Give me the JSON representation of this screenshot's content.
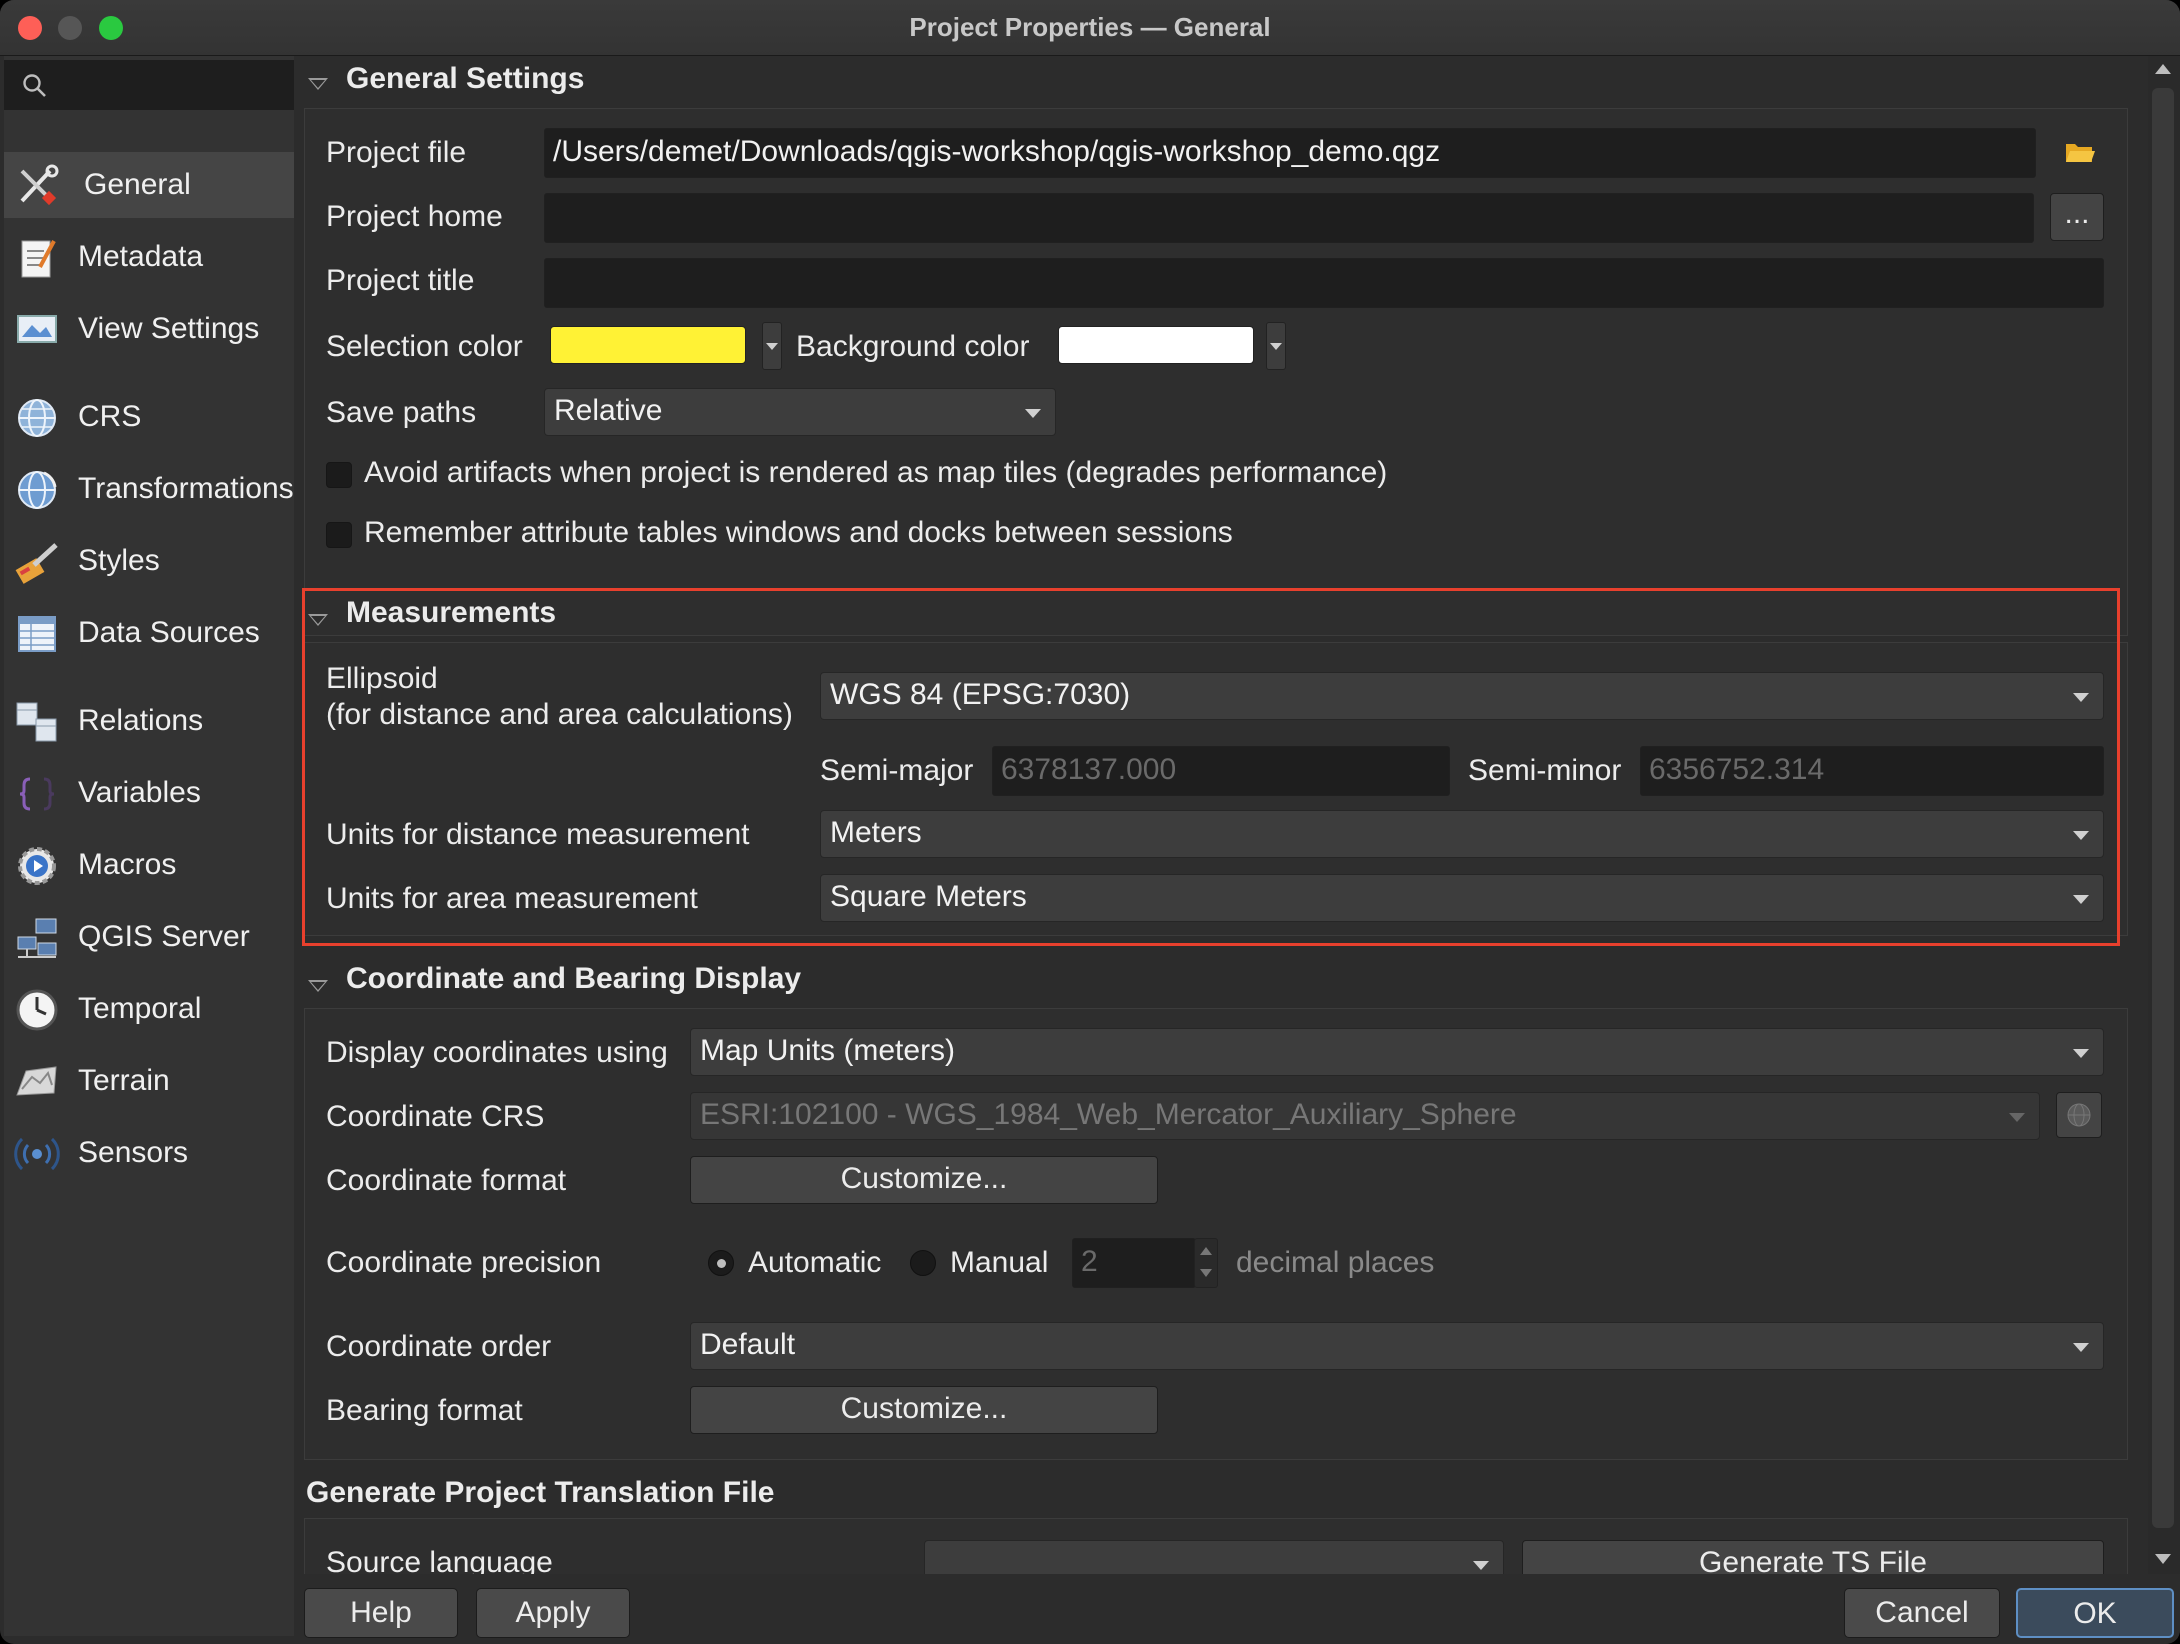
{
  "window": {
    "title": "Project Properties — General"
  },
  "sidebar": {
    "search_placeholder": "",
    "items": [
      {
        "label": "General",
        "icon": "general-tools-icon"
      },
      {
        "label": "Metadata",
        "icon": "metadata-icon"
      },
      {
        "label": "View Settings",
        "icon": "view-settings-icon"
      },
      {
        "label": "CRS",
        "icon": "crs-globe-icon"
      },
      {
        "label": "Transformations",
        "icon": "transformations-icon"
      },
      {
        "label": "Styles",
        "icon": "styles-brush-icon"
      },
      {
        "label": "Data Sources",
        "icon": "data-sources-icon"
      },
      {
        "label": "Relations",
        "icon": "relations-icon"
      },
      {
        "label": "Variables",
        "icon": "variables-icon"
      },
      {
        "label": "Macros",
        "icon": "macros-icon"
      },
      {
        "label": "QGIS Server",
        "icon": "qgis-server-icon"
      },
      {
        "label": "Temporal",
        "icon": "temporal-clock-icon"
      },
      {
        "label": "Terrain",
        "icon": "terrain-icon"
      },
      {
        "label": "Sensors",
        "icon": "sensors-icon"
      }
    ]
  },
  "general": {
    "header": "General Settings",
    "project_file_label": "Project file",
    "project_file_value": "/Users/demet/Downloads/qgis-workshop/qgis-workshop_demo.qgz",
    "project_home_label": "Project home",
    "project_home_value": "",
    "browse_label": "...",
    "project_title_label": "Project title",
    "project_title_value": "",
    "selection_color_label": "Selection color",
    "selection_color": "#fff235",
    "background_color_label": "Background color",
    "background_color": "#ffffff",
    "save_paths_label": "Save paths",
    "save_paths_value": "Relative",
    "avoid_artifacts_label": "Avoid artifacts when project is rendered as map tiles (degrades performance)",
    "remember_tables_label": "Remember attribute tables windows and docks between sessions"
  },
  "measurements": {
    "header": "Measurements",
    "ellipsoid_label_1": "Ellipsoid",
    "ellipsoid_label_2": "(for distance and area calculations)",
    "ellipsoid_value": "WGS 84 (EPSG:7030)",
    "semi_major_label": "Semi-major",
    "semi_major_value": "6378137.000",
    "semi_minor_label": "Semi-minor",
    "semi_minor_value": "6356752.314",
    "distance_units_label": "Units for distance measurement",
    "distance_units_value": "Meters",
    "area_units_label": "Units for area measurement",
    "area_units_value": "Square Meters",
    "highlight_color": "#e8402d"
  },
  "coordinates": {
    "header": "Coordinate and Bearing Display",
    "display_label": "Display coordinates using",
    "display_value": "Map Units (meters)",
    "crs_label": "Coordinate CRS",
    "crs_value": "ESRI:102100 - WGS_1984_Web_Mercator_Auxiliary_Sphere",
    "format_label": "Coordinate format",
    "format_button": "Customize...",
    "precision_label": "Coordinate precision",
    "automatic_label": "Automatic",
    "manual_label": "Manual",
    "precision_value": "2",
    "decimal_places_label": "decimal places",
    "order_label": "Coordinate order",
    "order_value": "Default",
    "bearing_label": "Bearing format",
    "bearing_button": "Customize..."
  },
  "translation": {
    "header": "Generate Project Translation File",
    "source_language_label": "Source language",
    "source_language_value": "",
    "generate_button": "Generate TS File"
  },
  "buttons": {
    "help": "Help",
    "apply": "Apply",
    "cancel": "Cancel",
    "ok": "OK"
  }
}
